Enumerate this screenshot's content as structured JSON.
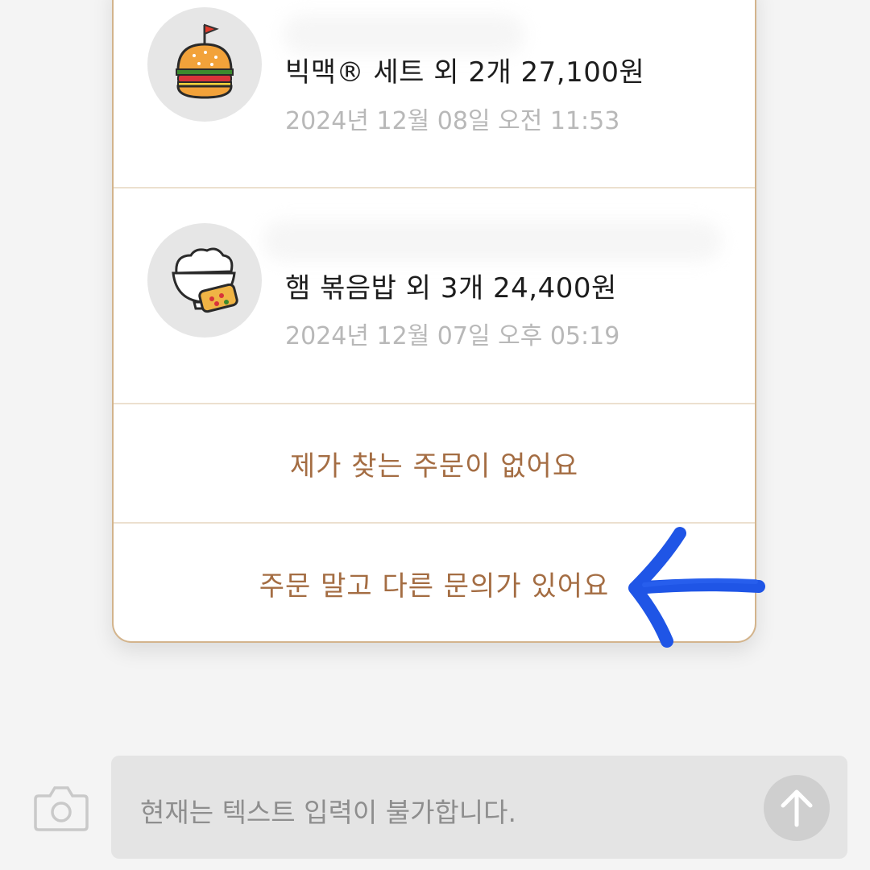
{
  "orders": [
    {
      "title": "빅맥® 세트 외 2개 27,100원",
      "date": "2024년 12월 08일 오전 11:53",
      "icon": "burger-icon"
    },
    {
      "title": "햄 볶음밥 외 3개 24,400원",
      "date": "2024년 12월 07일 오후 05:19",
      "icon": "fried-rice-icon"
    }
  ],
  "options": {
    "not_found_label": "제가 찾는 주문이 없어요",
    "other_inquiry_label": "주문 말고 다른 문의가 있어요"
  },
  "composer": {
    "placeholder": "현재는 텍스트 입력이 불가합니다.",
    "camera_icon": "camera-icon",
    "send_icon": "arrow-up-icon"
  },
  "colors": {
    "accent": "#a46d43",
    "card_border": "#d3b48c",
    "annotation": "#1f55e6"
  }
}
